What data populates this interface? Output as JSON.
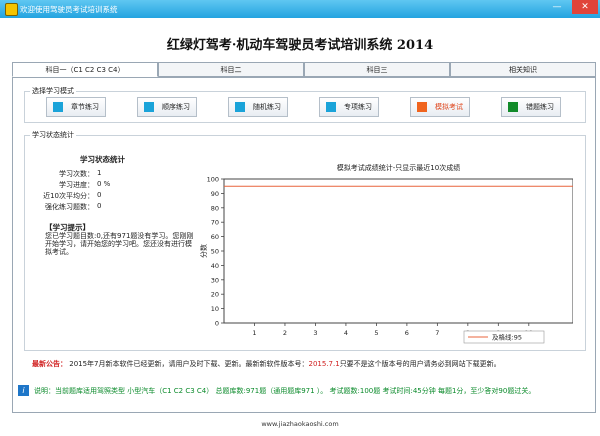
{
  "window": {
    "title": "欢迎使用驾驶员考试培训系统",
    "minimize": "—",
    "close": "✕"
  },
  "app_title": "红绿灯驾考·机动车驾驶员考试培训系统 2014",
  "tabs": [
    {
      "label": "科目一（C1 C2 C3 C4）",
      "active": true
    },
    {
      "label": "科目二",
      "active": false
    },
    {
      "label": "科目三",
      "active": false
    },
    {
      "label": "相关知识",
      "active": false
    }
  ],
  "mode_group": {
    "label": "选择学习模式",
    "buttons": [
      {
        "label": "章节练习",
        "color": "#1aa3d9"
      },
      {
        "label": "顺序练习",
        "color": "#1aa3d9"
      },
      {
        "label": "随机练习",
        "color": "#1aa3d9"
      },
      {
        "label": "专项练习",
        "color": "#1aa3d9"
      },
      {
        "label": "模拟考试",
        "color": "#f0641e",
        "text_color": "#e0441a"
      },
      {
        "label": "错题练习",
        "color": "#118a2a"
      }
    ]
  },
  "stats_group": {
    "label": "学习状态统计",
    "title": "学习状态统计",
    "items": [
      {
        "label": "学习次数：",
        "value": "1"
      },
      {
        "label": "学习进度：",
        "value": "0 %"
      },
      {
        "label": "近10次平均分：",
        "value": "0"
      },
      {
        "label": "强化练习题数：",
        "value": "0"
      }
    ],
    "tip_title": "【学习提示】",
    "tip_body": "您已学习题目数:0,还有971题没有学习。您刚刚开始学习，请开始您的学习吧。您还没有进行模拟考试。"
  },
  "chart_data": {
    "type": "line",
    "title": "模拟考试成绩统计-只显示最近10次成绩",
    "ylabel": "分数",
    "xlabel": "",
    "categories": [
      "1",
      "2",
      "3",
      "4",
      "5",
      "6",
      "7",
      "8",
      "9",
      "10"
    ],
    "ylim": [
      0,
      100
    ],
    "yticks": [
      0,
      10,
      20,
      30,
      40,
      50,
      60,
      70,
      80,
      90,
      100
    ],
    "series": [
      {
        "name": "及格线:95",
        "values": [
          95,
          95,
          95,
          95,
          95,
          95,
          95,
          95,
          95,
          95
        ],
        "color": "#e8643c"
      }
    ],
    "legend_position": "bottom-right",
    "grid": false
  },
  "notice": {
    "label": "最新公告：",
    "text1": "2015年7月新本软件已经更新，请用户及时下载、更新。最新新软件版本号：",
    "version": "2015.7.1",
    "text2": "只要不是这个版本号的用户请务必到网站下载更新。"
  },
  "description": "说明：当前题库适用驾照类型 小型汽车（C1 C2 C3 C4） 总题库数:971题（通用题库971 ）。 考试题数:100题 考试时间:45分钟  每题1分，至少答对90题过关。",
  "footer": "www.jiazhaokaoshi.com"
}
